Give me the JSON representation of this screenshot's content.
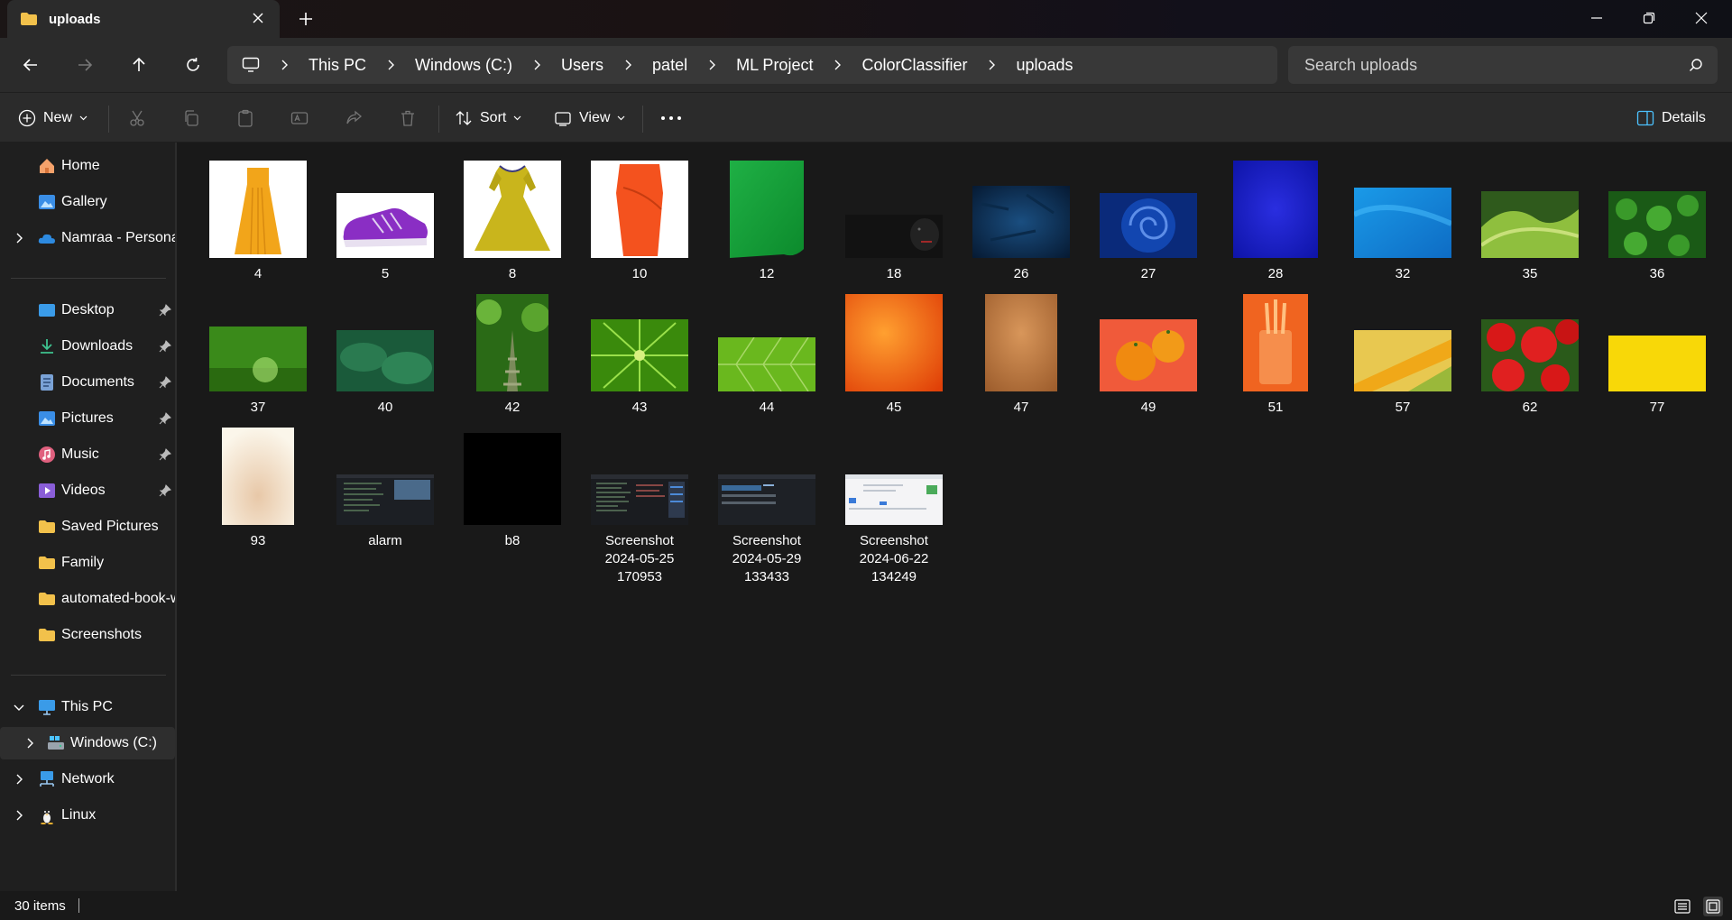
{
  "window": {
    "tab_title": "uploads",
    "colors": {
      "folder": "#f2c14b",
      "accent": "#4cc2ff"
    }
  },
  "nav": {
    "breadcrumbs": [
      "This PC",
      "Windows (C:)",
      "Users",
      "patel",
      "ML Project",
      "ColorClassifier",
      "uploads"
    ],
    "search_placeholder": "Search uploads"
  },
  "toolbar": {
    "new_label": "New",
    "sort_label": "Sort",
    "view_label": "View",
    "details_label": "Details"
  },
  "sidebar": {
    "top": [
      {
        "label": "Home",
        "icon": "home-icon"
      },
      {
        "label": "Gallery",
        "icon": "gallery-icon"
      },
      {
        "label": "Namraa - Personal",
        "icon": "onedrive-icon"
      }
    ],
    "quick": [
      {
        "label": "Desktop",
        "icon": "desktop-icon",
        "pinned": true
      },
      {
        "label": "Downloads",
        "icon": "downloads-icon",
        "pinned": true
      },
      {
        "label": "Documents",
        "icon": "documents-icon",
        "pinned": true
      },
      {
        "label": "Pictures",
        "icon": "pictures-icon",
        "pinned": true
      },
      {
        "label": "Music",
        "icon": "music-icon",
        "pinned": true
      },
      {
        "label": "Videos",
        "icon": "videos-icon",
        "pinned": true
      },
      {
        "label": "Saved Pictures",
        "icon": "folder-icon"
      },
      {
        "label": "Family",
        "icon": "folder-icon"
      },
      {
        "label": "automated-book-w",
        "icon": "folder-icon"
      },
      {
        "label": "Screenshots",
        "icon": "folder-icon"
      }
    ],
    "tree": [
      {
        "label": "This PC",
        "icon": "pc-icon",
        "expanded": true
      },
      {
        "label": "Windows (C:)",
        "icon": "drive-icon",
        "selected": true
      },
      {
        "label": "Network",
        "icon": "network-icon"
      },
      {
        "label": "Linux",
        "icon": "linux-icon"
      }
    ]
  },
  "files": [
    {
      "name": "4",
      "kind": "dress-orange"
    },
    {
      "name": "5",
      "kind": "shoe-purple"
    },
    {
      "name": "8",
      "kind": "dress-yellow"
    },
    {
      "name": "10",
      "kind": "skirt-orange"
    },
    {
      "name": "12",
      "kind": "green-paper"
    },
    {
      "name": "18",
      "kind": "dark-dog"
    },
    {
      "name": "26",
      "kind": "dark-blue"
    },
    {
      "name": "27",
      "kind": "blue-rose"
    },
    {
      "name": "28",
      "kind": "blue-powder"
    },
    {
      "name": "32",
      "kind": "light-blue"
    },
    {
      "name": "35",
      "kind": "green-glass"
    },
    {
      "name": "36",
      "kind": "clover"
    },
    {
      "name": "37",
      "kind": "grass-sphere"
    },
    {
      "name": "40",
      "kind": "green-leaves"
    },
    {
      "name": "42",
      "kind": "forest-steps"
    },
    {
      "name": "43",
      "kind": "green-plant"
    },
    {
      "name": "44",
      "kind": "green-leaf"
    },
    {
      "name": "45",
      "kind": "orange-texture"
    },
    {
      "name": "47",
      "kind": "copper"
    },
    {
      "name": "49",
      "kind": "oranges"
    },
    {
      "name": "51",
      "kind": "orange-glass"
    },
    {
      "name": "57",
      "kind": "corn"
    },
    {
      "name": "62",
      "kind": "red-flowers"
    },
    {
      "name": "77",
      "kind": "yellow"
    },
    {
      "name": "93",
      "kind": "cream"
    },
    {
      "name": "alarm",
      "kind": "screen-dark"
    },
    {
      "name": "b8",
      "kind": "black"
    },
    {
      "name": "Screenshot 2024-05-25 170953",
      "kind": "screen-code"
    },
    {
      "name": "Screenshot 2024-05-29 133433",
      "kind": "screen-dark2"
    },
    {
      "name": "Screenshot 2024-06-22 134249",
      "kind": "screen-light"
    }
  ],
  "status": {
    "item_count": "30 items"
  }
}
